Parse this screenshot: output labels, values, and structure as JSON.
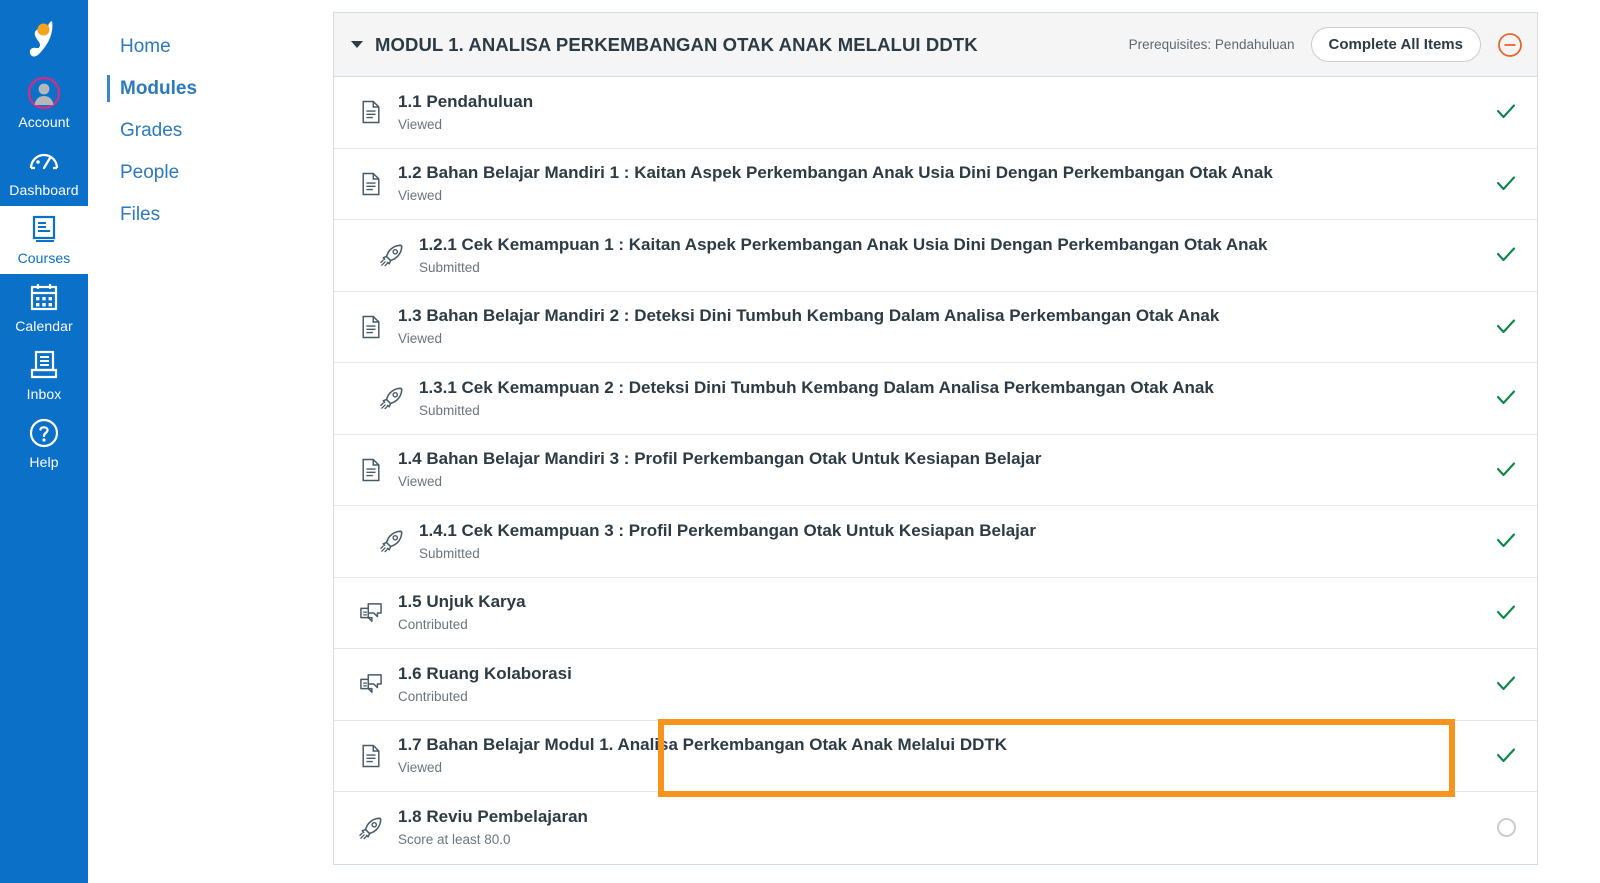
{
  "global_nav": {
    "logo": "institution-logo",
    "items": [
      {
        "label": "Account",
        "icon": "user-avatar-icon",
        "active": false
      },
      {
        "label": "Dashboard",
        "icon": "dashboard-gauge-icon",
        "active": false
      },
      {
        "label": "Courses",
        "icon": "courses-book-icon",
        "active": true
      },
      {
        "label": "Calendar",
        "icon": "calendar-icon",
        "active": false
      },
      {
        "label": "Inbox",
        "icon": "inbox-tray-icon",
        "active": false
      },
      {
        "label": "Help",
        "icon": "help-question-icon",
        "active": false
      }
    ]
  },
  "course_nav": {
    "items": [
      {
        "label": "Home",
        "active": false
      },
      {
        "label": "Modules",
        "active": true
      },
      {
        "label": "Grades",
        "active": false
      },
      {
        "label": "People",
        "active": false
      },
      {
        "label": "Files",
        "active": false
      }
    ]
  },
  "module": {
    "collapse_icon": "caret-down-icon",
    "title": "MODUL 1. ANALISA PERKEMBANGAN OTAK ANAK MELALUI DDTK",
    "prerequisites": "Prerequisites: Pendahuluan",
    "complete_all_label": "Complete All Items",
    "status_icon": "circle-minus-icon",
    "items": [
      {
        "title": "1.1 Pendahuluan",
        "subtitle": "Viewed",
        "icon": "document-page-icon",
        "indent": false,
        "status": "complete"
      },
      {
        "title": "1.2 Bahan Belajar Mandiri 1 : Kaitan Aspek Perkembangan Anak Usia Dini Dengan Perkembangan Otak Anak",
        "subtitle": "Viewed",
        "icon": "document-page-icon",
        "indent": false,
        "status": "complete"
      },
      {
        "title": "1.2.1 Cek Kemampuan 1 : Kaitan Aspek Perkembangan Anak Usia Dini Dengan Perkembangan Otak Anak",
        "subtitle": "Submitted",
        "icon": "quiz-rocket-icon",
        "indent": true,
        "status": "complete"
      },
      {
        "title": "1.3 Bahan Belajar Mandiri 2 : Deteksi Dini Tumbuh Kembang Dalam Analisa Perkembangan Otak Anak",
        "subtitle": "Viewed",
        "icon": "document-page-icon",
        "indent": false,
        "status": "complete"
      },
      {
        "title": "1.3.1 Cek Kemampuan 2 : Deteksi Dini Tumbuh Kembang Dalam Analisa Perkembangan Otak Anak",
        "subtitle": "Submitted",
        "icon": "quiz-rocket-icon",
        "indent": true,
        "status": "complete"
      },
      {
        "title": "1.4 Bahan Belajar Mandiri 3 : Profil Perkembangan Otak Untuk Kesiapan Belajar",
        "subtitle": "Viewed",
        "icon": "document-page-icon",
        "indent": false,
        "status": "complete"
      },
      {
        "title": "1.4.1 Cek Kemampuan 3 : Profil Perkembangan Otak Untuk Kesiapan Belajar",
        "subtitle": "Submitted",
        "icon": "quiz-rocket-icon",
        "indent": true,
        "status": "complete"
      },
      {
        "title": "1.5 Unjuk Karya",
        "subtitle": "Contributed",
        "icon": "discussion-bubbles-icon",
        "indent": false,
        "status": "complete"
      },
      {
        "title": "1.6 Ruang Kolaborasi",
        "subtitle": "Contributed",
        "icon": "discussion-bubbles-icon",
        "indent": false,
        "status": "complete"
      },
      {
        "title": "1.7 Bahan Belajar Modul 1. Analisa Perkembangan Otak Anak Melalui DDTK",
        "subtitle": "Viewed",
        "icon": "document-page-icon",
        "indent": false,
        "status": "complete",
        "highlighted": true
      },
      {
        "title": "1.8 Reviu Pembelajaran",
        "subtitle": "Score at least 80.0",
        "icon": "quiz-rocket-icon",
        "indent": false,
        "status": "incomplete"
      }
    ]
  },
  "colors": {
    "brand_blue": "#0a70c8",
    "link_blue": "#2b7abc",
    "text_dark": "#2d3b45",
    "muted": "#6b757d",
    "complete_green": "#0b874b",
    "highlight_orange": "#f7941d",
    "status_orange": "#e8662b",
    "header_bg": "#f5f5f5",
    "border": "#d5dce2"
  }
}
